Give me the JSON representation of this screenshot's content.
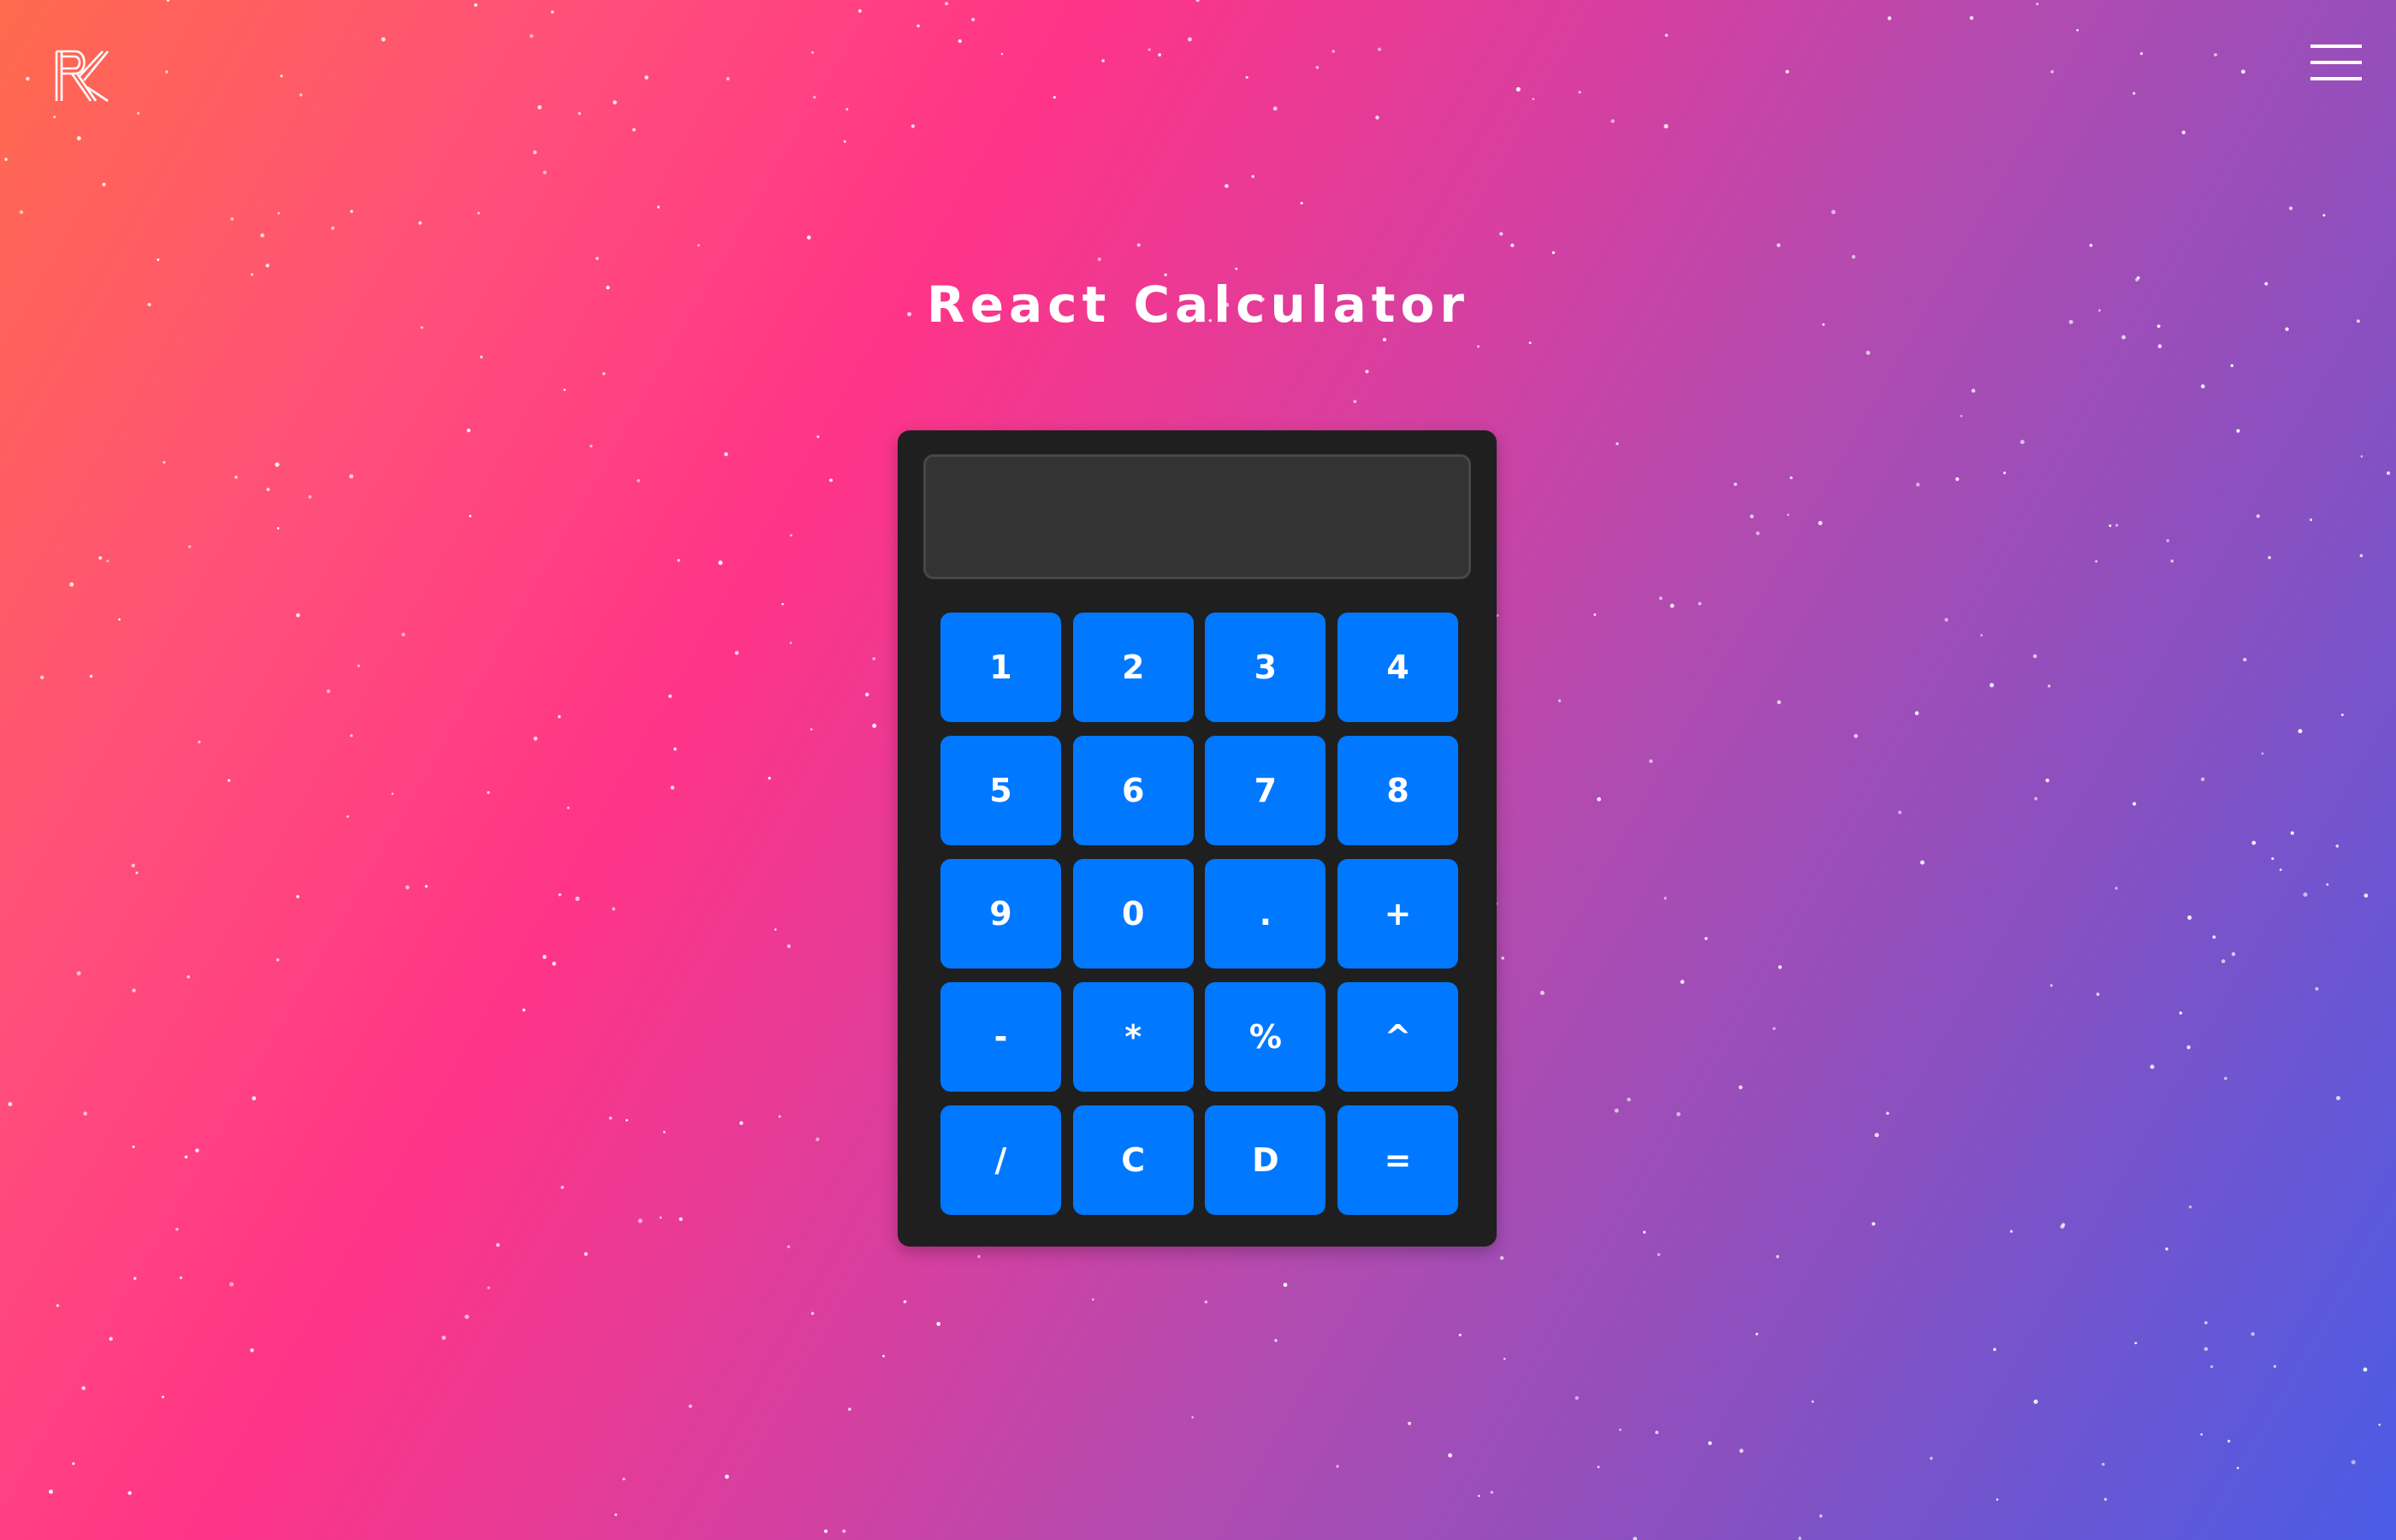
{
  "header": {
    "logo_icon": "react-r-logo-icon",
    "menu_icon": "hamburger-menu-icon"
  },
  "title": "React Calculator",
  "display": {
    "value": ""
  },
  "keys": [
    "1",
    "2",
    "3",
    "4",
    "5",
    "6",
    "7",
    "8",
    "9",
    "0",
    ".",
    "+",
    "-",
    "*",
    "%",
    "^",
    "/",
    "C",
    "D",
    "="
  ],
  "colors": {
    "key_background": "#0078ff",
    "calculator_body": "#1f1f1f",
    "display_background": "#333333",
    "text": "#ffffff",
    "gradient": [
      "#ff6a4d",
      "#ff3488",
      "#b24bb0",
      "#4a5ce6"
    ]
  }
}
